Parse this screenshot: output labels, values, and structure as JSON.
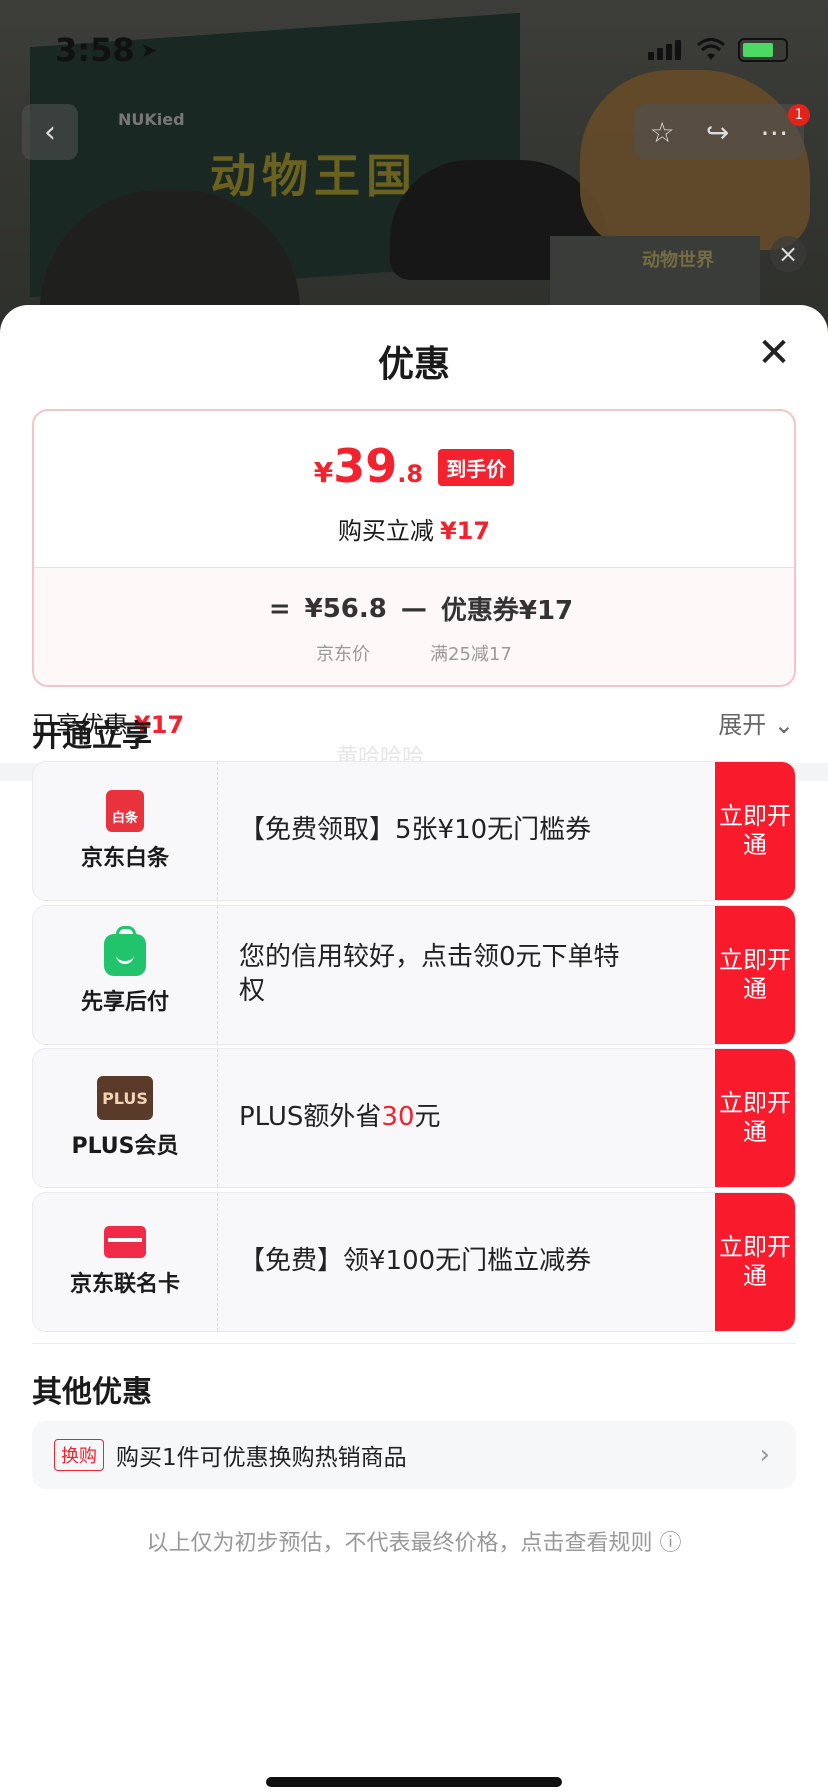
{
  "status_bar": {
    "time": "3:58"
  },
  "background": {
    "box_title": "动物王国",
    "brand": "NUKied",
    "mini_window_label": "动物世界",
    "badge_count": "1"
  },
  "sheet": {
    "title": "优惠",
    "price_card": {
      "final_currency": "¥",
      "final_int": "39",
      "final_dec": ".8",
      "final_tag": "到手价",
      "reduce_label": "购买立减",
      "reduce_value": "¥17",
      "eq": "=",
      "jd_price": "¥56.8",
      "minus": "—",
      "coupon": "优惠券¥17",
      "jd_price_label": "京东价",
      "coupon_condition": "满25减17"
    },
    "enjoyed_label": "已享优惠",
    "enjoyed_value": "¥17",
    "expand_label": "展开",
    "open_section_title": "开通立享",
    "watermark": "黄哈哈哈",
    "offers": [
      {
        "name": "京东白条",
        "icon_text": "白条",
        "text": "【免费领取】5张¥10无门槛券",
        "btn": "立即开通"
      },
      {
        "name": "先享后付",
        "text": "您的信用较好，点击领0元下单特权",
        "btn": "立即开通"
      },
      {
        "name": "PLUS会员",
        "icon_text": "PLUS",
        "text_pre": "PLUS额外省",
        "text_red": "30",
        "text_post": "元",
        "btn": "立即开通"
      },
      {
        "name": "京东联名卡",
        "text": "【免费】领¥100无门槛立减券",
        "btn": "立即开通"
      }
    ],
    "other_section_title": "其他优惠",
    "other_item": {
      "tag": "换购",
      "text": "购买1件可优惠换购热销商品"
    },
    "footnote": "以上仅为初步预估，不代表最终价格，点击查看规则"
  },
  "icons": [
    "location-arrow-icon",
    "signal-icon",
    "wifi-icon",
    "battery-icon",
    "back-icon",
    "star-icon",
    "share-icon",
    "more-icon",
    "close-icon",
    "chevron-down-icon",
    "baitiao-icon",
    "shopping-bag-icon",
    "plus-member-icon",
    "credit-card-icon",
    "chevron-right-icon",
    "info-icon"
  ],
  "colors": {
    "accent_red": "#f2222e",
    "button_red": "#f91a2c",
    "pay_green": "#21c46a",
    "plus_brown": "#5a3b2a"
  }
}
